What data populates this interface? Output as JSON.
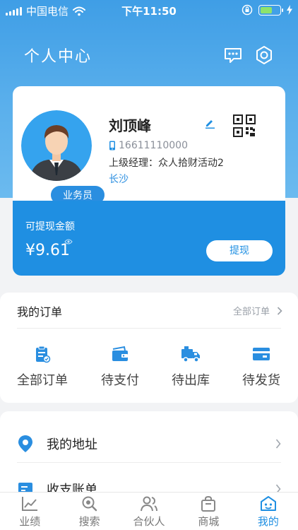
{
  "status_bar": {
    "carrier": "中国电信",
    "time": "下午11:50"
  },
  "header": {
    "title": "个人中心"
  },
  "profile": {
    "name": "刘顶峰",
    "role": "业务员",
    "phone": "16611110000",
    "manager": "上级经理：众人拾财活动2",
    "city": "长沙"
  },
  "balance": {
    "label": "可提现金额",
    "amount": "¥9.61",
    "withdraw_label": "提现"
  },
  "orders": {
    "title": "我的订单",
    "all_label": "全部订单",
    "items": [
      {
        "label": "全部订单",
        "icon": "clipboard-icon"
      },
      {
        "label": "待支付",
        "icon": "wallet-icon"
      },
      {
        "label": "待出库",
        "icon": "truck-icon"
      },
      {
        "label": "待发货",
        "icon": "card-icon"
      }
    ]
  },
  "menu": [
    {
      "label": "我的地址",
      "icon": "location-pin-icon"
    },
    {
      "label": "收支账单",
      "icon": "bill-icon"
    }
  ],
  "tabs": [
    {
      "label": "业绩",
      "icon": "chart-icon"
    },
    {
      "label": "搜索",
      "icon": "search-icon"
    },
    {
      "label": "合伙人",
      "icon": "people-icon"
    },
    {
      "label": "商城",
      "icon": "bag-icon"
    },
    {
      "label": "我的",
      "icon": "profile-icon",
      "active": true
    }
  ],
  "colors": {
    "accent": "#1f8fe2",
    "header": "#4aa6e9",
    "text": "#222222"
  }
}
